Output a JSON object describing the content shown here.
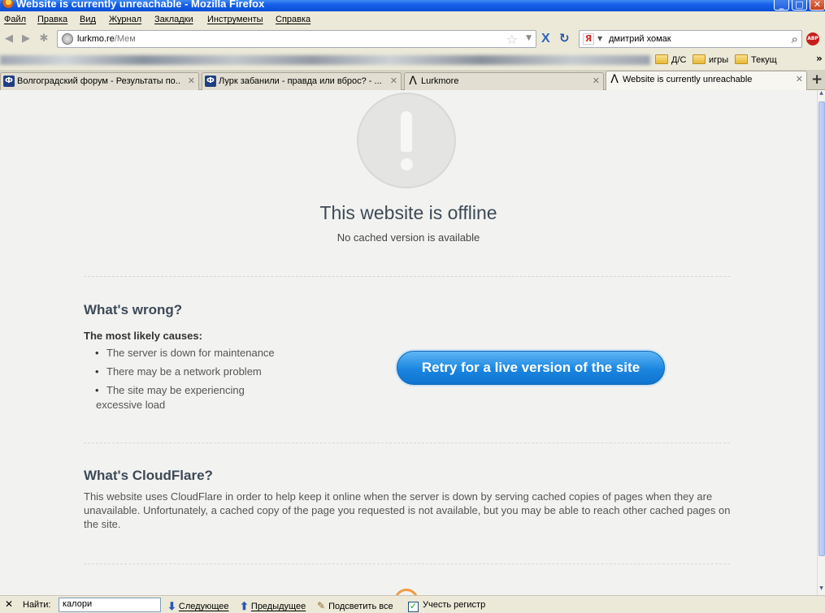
{
  "window": {
    "title": "Website is currently unreachable - Mozilla Firefox",
    "minimize": "_",
    "maximize": "□",
    "close": "✕"
  },
  "menu": [
    "Файл",
    "Правка",
    "Вид",
    "Журнал",
    "Закладки",
    "Инструменты",
    "Справка"
  ],
  "nav": {
    "url_host": "lurkmo.re",
    "url_path": "/Мем",
    "search_value": "дмитрий хомак",
    "search_engine": "Я",
    "adblock": "ABP"
  },
  "bookmarks": {
    "items": [
      "Д/С",
      "игры",
      "Текущ"
    ],
    "more": "»"
  },
  "tabs": [
    {
      "label": "Волгоградский форум - Результаты по...",
      "icon": "Ф"
    },
    {
      "label": "Лурк забанили - правда или вброс? - ...",
      "icon": "Ф"
    },
    {
      "label": "Lurkmore",
      "icon": "Λ"
    },
    {
      "label": "Website is currently unreachable",
      "icon": "Λ"
    }
  ],
  "page": {
    "title": "This website is offline",
    "subtitle": "No cached version is available",
    "wrong_title": "What's wrong?",
    "causes_title": "The most likely causes:",
    "causes": [
      "The server is down for maintenance",
      "There may be a network problem",
      "The site may be experiencing excessive load"
    ],
    "retry_label": "Retry for a live version of the site",
    "cf_title": "What's CloudFlare?",
    "cf_text": "This website uses CloudFlare in order to help keep it online when the server is down by serving cached copies of pages when they are unavailable. Unfortunately, a cached copy of the page you requested is not available, but you may be able to reach other cached pages on the site."
  },
  "findbar": {
    "close": "✕",
    "label": "Найти:",
    "value": "калори",
    "next": "Следующее",
    "prev": "Предыдущее",
    "highlight": "Подсветить все",
    "match_case": "Учесть регистр"
  },
  "colors": {
    "accent": "#1a86e0",
    "heading": "#3d4a57",
    "xp_title": "#0a4fd6"
  }
}
